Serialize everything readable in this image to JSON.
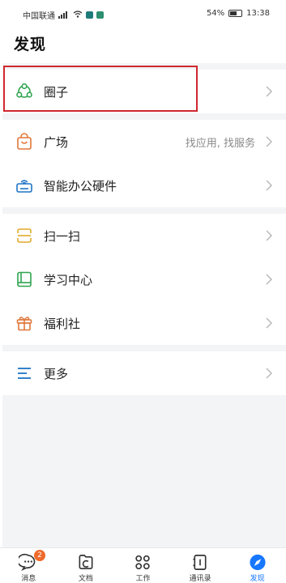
{
  "status_bar": {
    "carrier": "中国联通",
    "battery": "54%",
    "time": "13:38"
  },
  "page": {
    "title": "发现"
  },
  "items": [
    {
      "label": "圈子",
      "icon": "circle-group-icon"
    },
    {
      "label": "广场",
      "sub": "找应用, 找服务",
      "icon": "shopping-bag-icon"
    },
    {
      "label": "智能办公硬件",
      "icon": "printer-icon"
    },
    {
      "label": "扫一扫",
      "icon": "scan-icon"
    },
    {
      "label": "学习中心",
      "icon": "book-icon"
    },
    {
      "label": "福利社",
      "icon": "gift-icon"
    },
    {
      "label": "更多",
      "icon": "menu-icon"
    }
  ],
  "tabbar": {
    "tabs": [
      {
        "label": "消息",
        "badge": "2",
        "icon": "chat-icon"
      },
      {
        "label": "文档",
        "icon": "document-icon"
      },
      {
        "label": "工作",
        "icon": "grid-icon"
      },
      {
        "label": "通讯录",
        "icon": "contacts-icon"
      },
      {
        "label": "发现",
        "icon": "compass-icon",
        "active": true
      }
    ]
  },
  "colors": {
    "accent": "#1677ff",
    "highlight": "#d0282e",
    "green": "#2ea44f",
    "orange": "#e0773a",
    "blue": "#1f74c7",
    "yellow": "#e2a92a",
    "badge": "#ef6a2b"
  }
}
